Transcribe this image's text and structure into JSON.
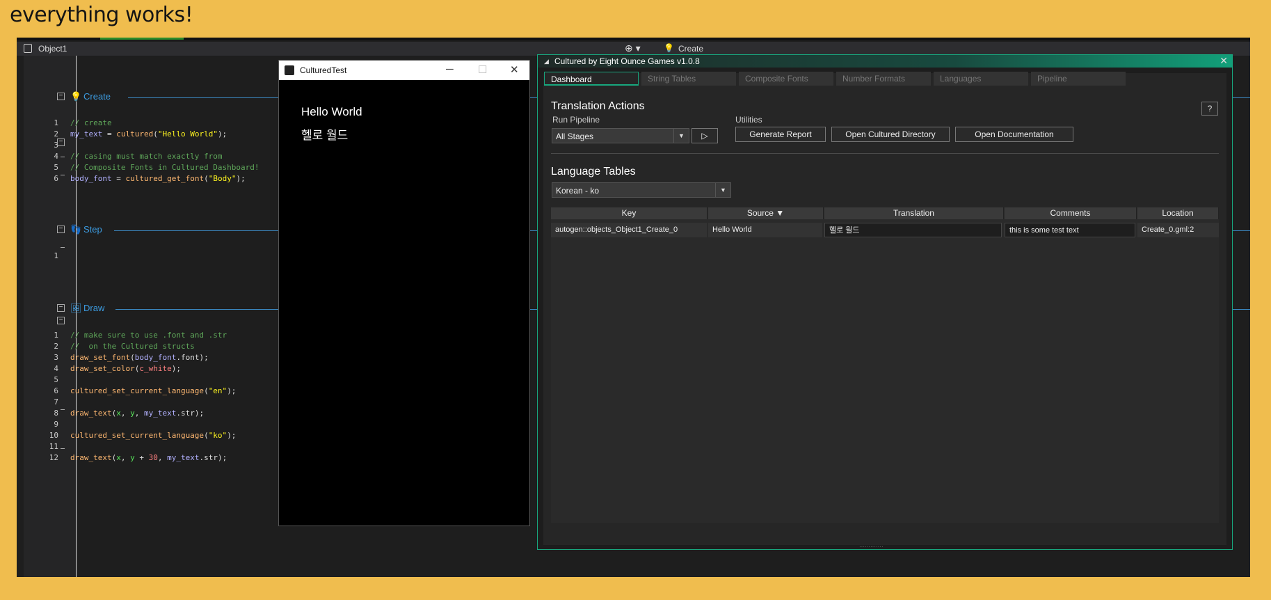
{
  "banner": "everything works!",
  "ide": {
    "object_name": "Object1",
    "current_event": "Create",
    "events": [
      {
        "name": "Create",
        "lines": [
          "// create",
          "my_text = cultured(\"Hello World\");",
          "",
          "// casing must match exactly from",
          "// Composite Fonts in Cultured Dashboard!",
          "body_font = cultured_get_font(\"Body\");"
        ]
      },
      {
        "name": "Step",
        "lines": [
          ""
        ]
      },
      {
        "name": "Draw",
        "lines": [
          "// make sure to use .font and .str",
          "//  on the Cultured structs",
          "draw_set_font(body_font.font);",
          "draw_set_color(c_white);",
          "",
          "cultured_set_current_language(\"en\");",
          "",
          "draw_text(x, y, my_text.str);",
          "",
          "cultured_set_current_language(\"ko\");",
          "",
          "draw_text(x, y + 30, my_text.str);"
        ]
      }
    ]
  },
  "game_window": {
    "title": "CulturedTest",
    "lines": [
      "Hello World",
      "헬로 월드"
    ]
  },
  "panel": {
    "title": "Cultured by Eight Ounce Games  v1.0.8",
    "tabs": [
      "Dashboard",
      "String Tables",
      "Composite Fonts",
      "Number Formats",
      "Languages",
      "Pipeline"
    ],
    "active_tab": "Dashboard",
    "translation_actions": {
      "title": "Translation Actions",
      "run_pipeline_label": "Run Pipeline",
      "pipeline_value": "All Stages",
      "utilities_label": "Utilities",
      "buttons": [
        "Generate Report",
        "Open Cultured Directory",
        "Open Documentation"
      ],
      "help": "?"
    },
    "language_tables": {
      "title": "Language Tables",
      "language_value": "Korean - ko",
      "columns": [
        "Key",
        "Source ▼",
        "Translation",
        "Comments",
        "Location"
      ],
      "rows": [
        {
          "key": "autogen::objects_Object1_Create_0",
          "source": "Hello World",
          "translation": "헬로 월드",
          "comments": "this is some test text",
          "location": "Create_0.gml:2"
        }
      ]
    }
  }
}
